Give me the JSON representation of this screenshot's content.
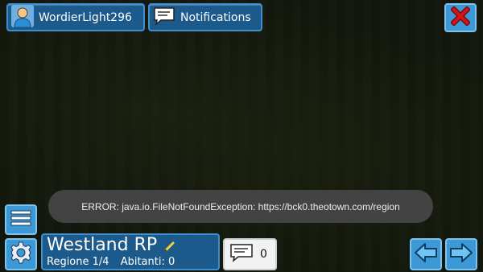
{
  "header": {
    "username": "WordierLight296",
    "notifications_label": "Notifications"
  },
  "city": {
    "name": "Westland RP",
    "region": "Regione 1/4",
    "inhabitants": "Abitanti: 0"
  },
  "chat": {
    "count": "0"
  },
  "toast": {
    "message": "ERROR: java.io.FileNotFoundException: https://bck0.theotown.com/region"
  },
  "icons": {
    "user": "user-avatar-icon",
    "notifications": "speech-bubble-icon",
    "close": "close-x-icon",
    "menu": "hamburger-menu-icon",
    "settings": "gear-icon",
    "edit": "pencil-icon",
    "chat": "speech-bubble-icon",
    "prev": "arrow-left-icon",
    "next": "arrow-right-icon"
  },
  "colors": {
    "panel": "#1d5a8c",
    "button": "#3c99d6",
    "close_x": "#d0161b",
    "toast_bg": "#464646"
  }
}
